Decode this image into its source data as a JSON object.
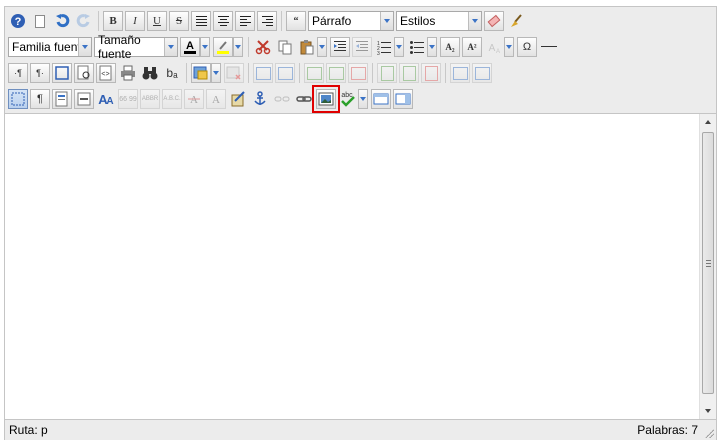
{
  "toolbar": {
    "format_select": "Párrafo",
    "styles_select": "Estilos",
    "font_family_select": "Familia fuente",
    "font_size_select": "Tamaño fuente",
    "glyphs": {
      "bold": "B",
      "italic": "I",
      "underline": "U",
      "strike": "S",
      "blockquote": "“",
      "subscript": "A₂",
      "superscript": "A²",
      "charmap": "Ω",
      "ltr": "·¶",
      "rtl": "¶·",
      "replace": "bₐ",
      "visualchars": "¶",
      "cite": "66 99",
      "abbr": "ABBR",
      "acronym": "A.B.C.",
      "spell_label": "abc"
    },
    "colors": {
      "forecolor": "#000000",
      "backcolor": "#ffff00",
      "accent_blue": "#3b73c6",
      "highlight_outline": "#e00000"
    }
  },
  "statusbar": {
    "path_label": "Ruta:",
    "path_value": "p",
    "word_count": "Palabras: 7"
  }
}
